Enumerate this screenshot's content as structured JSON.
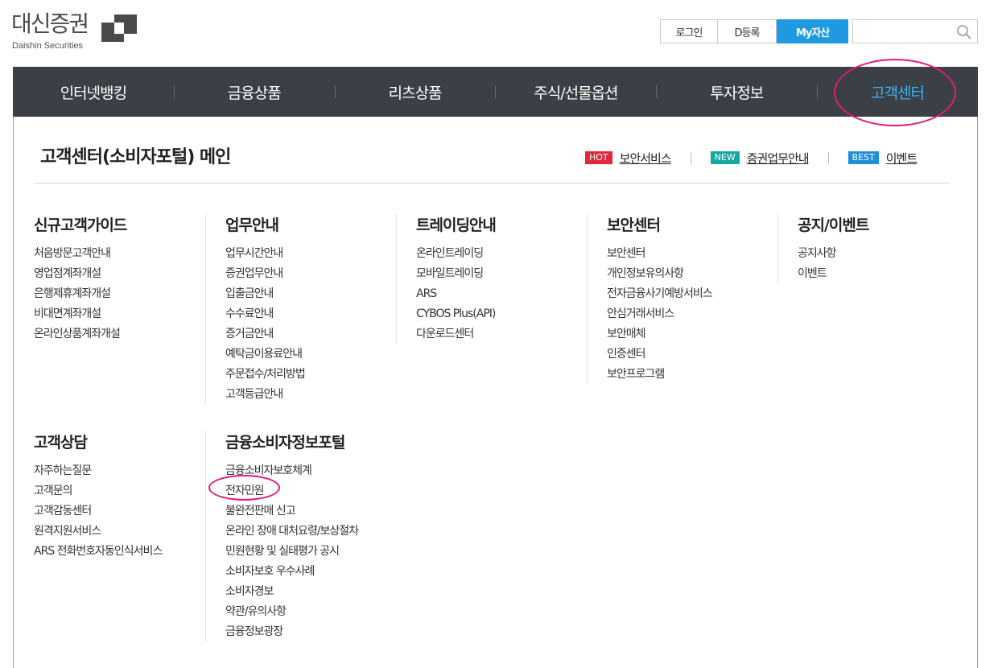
{
  "logo": {
    "name": "대신증권",
    "sub": "Daishin Securities"
  },
  "util": {
    "login": "로그인",
    "dreg": "D등록",
    "myasset": "My자산",
    "search_placeholder": ""
  },
  "gnb": [
    "인터넷뱅킹",
    "금융상품",
    "리츠상품",
    "주식/선물옵션",
    "투자정보",
    "고객센터"
  ],
  "gnb_active": "고객센터",
  "page": {
    "title": "고객센터(소비자포털) 메인",
    "quick_links": [
      {
        "badge": "HOT",
        "badge_color": "#e0283c",
        "label": "보안서비스"
      },
      {
        "badge": "NEW",
        "badge_color": "#16a79f",
        "label": "증권업무안내"
      },
      {
        "badge": "BEST",
        "badge_color": "#1e8fd8",
        "label": "이벤트"
      }
    ]
  },
  "sections": [
    {
      "title": "신규고객가이드",
      "items": [
        "처음방문고객안내",
        "영업점계좌개설",
        "은행제휴계좌개설",
        "비대면계좌개설",
        "온라인상품계좌개설"
      ]
    },
    {
      "title": "업무안내",
      "items": [
        "업무시간안내",
        "증권업무안내",
        "입출금안내",
        "수수료안내",
        "증거금안내",
        "예탁금이용료안내",
        "주문접수/처리방법",
        "고객등급안내"
      ]
    },
    {
      "title": "트레이딩안내",
      "items": [
        "온라인트레이딩",
        "모바일트레이딩",
        "ARS",
        "CYBOS Plus(API)",
        "다운로드센터"
      ]
    },
    {
      "title": "보안센터",
      "items": [
        "보안센터",
        "개인정보유의사항",
        "전자금융사기예방서비스",
        "안심거래서비스",
        "보안매체",
        "인증센터",
        "보안프로그램"
      ]
    },
    {
      "title": "공지/이벤트",
      "items": [
        "공지사항",
        "이벤트"
      ]
    },
    {
      "title": "고객상담",
      "items": [
        "자주하는질문",
        "고객문의",
        "고객감동센터",
        "원격지원서비스",
        "ARS 전화번호자동인식서비스"
      ]
    },
    {
      "title": "금융소비자정보포털",
      "items": [
        "금융소비자보호체계",
        "전자민원",
        "불완전판매 신고",
        "온라인 장애 대처요령/보상절차",
        "민원현황 및 실태평가 공시",
        "소비자보호 우수사례",
        "소비자경보",
        "약관/유의사항",
        "금융정보광장"
      ]
    }
  ],
  "highlight_color": "#e4197a",
  "accent_color": "#1f9ae0"
}
